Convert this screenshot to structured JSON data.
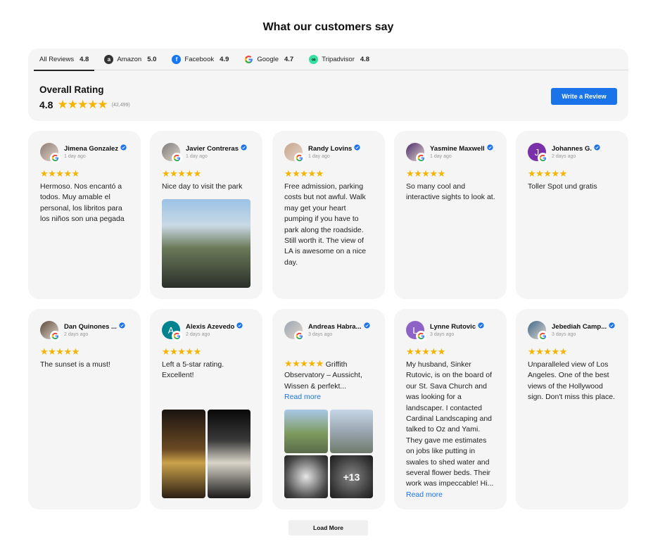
{
  "page_title": "What our customers say",
  "tabs": [
    {
      "label": "All Reviews",
      "rating": "4.8",
      "icon": "none"
    },
    {
      "label": "Amazon",
      "rating": "5.0",
      "icon": "amazon-icon"
    },
    {
      "label": "Facebook",
      "rating": "4.9",
      "icon": "facebook-icon"
    },
    {
      "label": "Google",
      "rating": "4.7",
      "icon": "google-icon"
    },
    {
      "label": "Tripadvisor",
      "rating": "4.8",
      "icon": "tripadvisor-icon"
    }
  ],
  "overall": {
    "label": "Overall Rating",
    "rating": "4.8",
    "count": "(42,499)",
    "stars": 5
  },
  "write_review": "Write a Review",
  "reviews": [
    {
      "name": "Jimena Gonzalez",
      "date": "1 day ago",
      "stars": 5,
      "text": "Hermoso. Nos encantó a todos. Muy amable el personal, los libritos para los niños son una pegada",
      "avatar_color": "#8d7b72",
      "initial": ""
    },
    {
      "name": "Javier Contreras",
      "date": "1 day ago",
      "stars": 5,
      "text": "Nice day to visit the park",
      "avatar_color": "#7b7b7b",
      "initial": ""
    },
    {
      "name": "Randy Lovins",
      "date": "1 day ago",
      "stars": 5,
      "text": "Free admission, parking costs but not awful. Walk may get your heart pumping if you have to park along the roadside. Still worth it. The view of LA is awesome on a nice day.",
      "avatar_color": "#c9a58a",
      "initial": ""
    },
    {
      "name": "Yasmine Maxwell",
      "date": "1 day ago",
      "stars": 5,
      "text": "So many cool and interactive sights to look at.",
      "avatar_color": "#4b2a6b",
      "initial": ""
    },
    {
      "name": "Johannes G.",
      "date": "2 days ago",
      "stars": 5,
      "text": "Toller Spot und gratis",
      "avatar_color": "#7b2fa8",
      "initial": "J"
    },
    {
      "name": "Dan Quinones ...",
      "date": "2 days ago",
      "stars": 5,
      "text": "The sunset is a must!",
      "avatar_color": "#5a4a3a",
      "initial": ""
    },
    {
      "name": "Alexis Azevedo",
      "date": "2 days ago",
      "stars": 5,
      "text": "Left a 5-star rating. Excellent!",
      "avatar_color": "#00838f",
      "initial": "A"
    },
    {
      "name": "Andreas Habra...",
      "date": "3 days ago",
      "stars": 5,
      "text": "Griffith Observatory – Aussicht, Wissen & perfekt...",
      "read_more": "Read more",
      "avatar_color": "#9aa5b1",
      "initial": "",
      "more_count": "+13"
    },
    {
      "name": "Lynne Rutovic",
      "date": "3 days ago",
      "stars": 5,
      "text": "My husband, Sinker Rutovic, is on the board of our St. Sava Church and was looking for a landscaper. I contacted Cardinal Landscaping and talked to Oz and Yami. They gave me estimates on jobs like putting in swales to shed water and several flower beds. Their work was impeccable! Hi...",
      "read_more": "Read more",
      "avatar_color": "#8e63c7",
      "initial": "L"
    },
    {
      "name": "Jebediah Camp...",
      "date": "3 days ago",
      "stars": 5,
      "text": "Unparalleled view of Los Angeles. One of the best views of the Hollywood sign. Don't miss this place.",
      "avatar_color": "#3d6a8a",
      "initial": ""
    }
  ],
  "load_more": "Load More",
  "colors": {
    "accent": "#1a73e8",
    "star": "#f5b400",
    "card_bg": "#f5f5f5"
  }
}
